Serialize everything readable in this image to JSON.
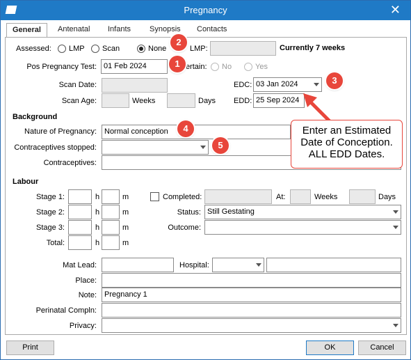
{
  "window": {
    "title": "Pregnancy"
  },
  "tabs": [
    "General",
    "Antenatal",
    "Infants",
    "Synopsis",
    "Contacts"
  ],
  "assessed": {
    "label": "Assessed:",
    "options": [
      "LMP",
      "Scan",
      "None"
    ],
    "selected": "None",
    "lmp_label": "LMP:",
    "lmp_value": "",
    "currently": "Currently 7 weeks"
  },
  "pos_test": {
    "label": "Pos Pregnancy Test:",
    "value": "01 Feb 2024",
    "certain_label": "Certain:",
    "certain_options": [
      "No",
      "Yes"
    ]
  },
  "scan": {
    "date_label": "Scan Date:",
    "age_label": "Scan Age:",
    "weeks_label": "Weeks",
    "days_label": "Days"
  },
  "edc": {
    "label": "EDC:",
    "value": "03 Jan 2024"
  },
  "edd": {
    "label": "EDD:",
    "value": "25 Sep 2024"
  },
  "background": {
    "heading": "Background",
    "nature_label": "Nature of Pregnancy:",
    "nature_value": "Normal conception",
    "contra_stopped_label": "Contraceptives stopped:",
    "contraceptives_label": "Contraceptives:"
  },
  "callout": {
    "text": "Enter an Estimated Date of Conception. ALL EDD Dates."
  },
  "badges": [
    "1",
    "2",
    "3",
    "4",
    "5"
  ],
  "labour": {
    "heading": "Labour",
    "stages": [
      "Stage 1:",
      "Stage 2:",
      "Stage 3:",
      "Total:"
    ],
    "h": "h",
    "m": "m",
    "completed_label": "Completed:",
    "at_label": "At:",
    "weeks_label": "Weeks",
    "days_label": "Days",
    "status_label": "Status:",
    "status_value": "Still Gestating",
    "outcome_label": "Outcome:"
  },
  "details": {
    "mat_lead_label": "Mat Lead:",
    "hospital_label": "Hospital:",
    "place_label": "Place:",
    "note_label": "Note:",
    "note_value": "Pregnancy 1",
    "perinatal_label": "Perinatal Compln:",
    "privacy_label": "Privacy:"
  },
  "buttons": {
    "print": "Print",
    "ok": "OK",
    "cancel": "Cancel"
  },
  "colors": {
    "titlebar": "#1f7ac6",
    "badge": "#e8463b"
  }
}
